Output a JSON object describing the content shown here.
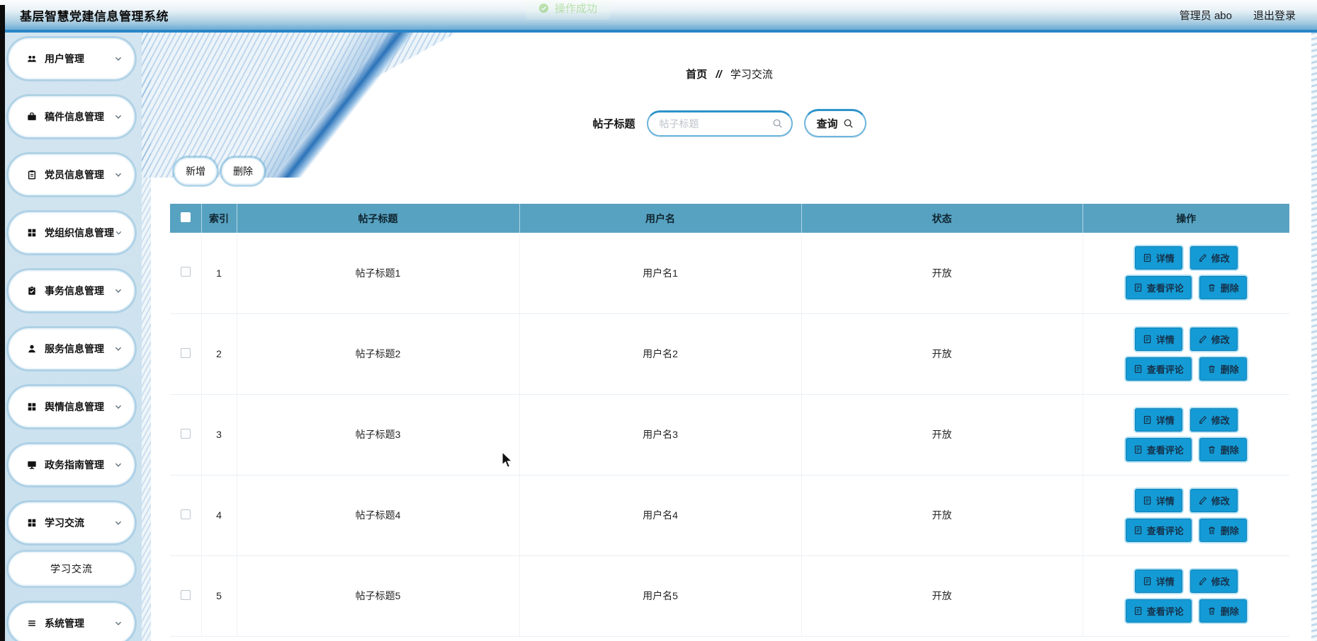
{
  "header": {
    "title": "基层智慧党建信息管理系统",
    "user": "管理员 abo",
    "logout": "退出登录"
  },
  "toast": {
    "text": "操作成功"
  },
  "sidebar": {
    "items": [
      {
        "name": "users",
        "label": "用户管理",
        "icon": "users-icon"
      },
      {
        "name": "manuscripts",
        "label": "稿件信息管理",
        "icon": "briefcase-icon"
      },
      {
        "name": "party-members",
        "label": "党员信息管理",
        "icon": "clipboard-icon"
      },
      {
        "name": "party-orgs",
        "label": "党组织信息管理",
        "icon": "grid-icon"
      },
      {
        "name": "affairs",
        "label": "事务信息管理",
        "icon": "clipboard-check-icon"
      },
      {
        "name": "services",
        "label": "服务信息管理",
        "icon": "user-icon"
      },
      {
        "name": "opinion",
        "label": "舆情信息管理",
        "icon": "grid-icon"
      },
      {
        "name": "gov-guide",
        "label": "政务指南管理",
        "icon": "monitor-icon"
      },
      {
        "name": "study-exchange",
        "label": "学习交流",
        "icon": "grid-icon",
        "children": [
          {
            "name": "study-exchange-list",
            "label": "学习交流",
            "active": true
          }
        ]
      },
      {
        "name": "system",
        "label": "系统管理",
        "icon": "menu-icon"
      }
    ]
  },
  "breadcrumb": {
    "home": "首页",
    "separator": "//",
    "current": "学习交流"
  },
  "search": {
    "label": "帖子标题",
    "placeholder": "帖子标题",
    "button": "查询"
  },
  "toolbar": {
    "add": "新增",
    "delete": "删除"
  },
  "table": {
    "headers": {
      "index": "索引",
      "title": "帖子标题",
      "username": "用户名",
      "status": "状态",
      "actions": "操作"
    },
    "action_labels": {
      "detail": "详情",
      "edit": "修改",
      "comments": "查看评论",
      "delete": "删除"
    },
    "rows": [
      {
        "index": "1",
        "title": "帖子标题1",
        "username": "用户名1",
        "status": "开放"
      },
      {
        "index": "2",
        "title": "帖子标题2",
        "username": "用户名2",
        "status": "开放"
      },
      {
        "index": "3",
        "title": "帖子标题3",
        "username": "用户名3",
        "status": "开放"
      },
      {
        "index": "4",
        "title": "帖子标题4",
        "username": "用户名4",
        "status": "开放"
      },
      {
        "index": "5",
        "title": "帖子标题5",
        "username": "用户名5",
        "status": "开放"
      }
    ]
  },
  "colors": {
    "header_accent": "#2a85c7",
    "table_header_bg": "#58a2c1",
    "action_button_bg": "#149bd5",
    "toast_green": "#67c23a",
    "sidebar_bg": "#cfe3ee"
  }
}
